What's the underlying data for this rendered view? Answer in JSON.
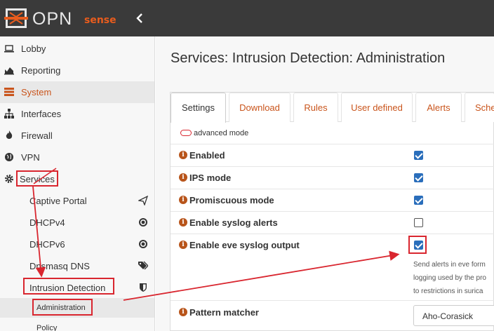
{
  "brand": {
    "word": "OPN",
    "sense": "sense",
    "collapse_icon": "chevron-left-icon"
  },
  "sidebar": {
    "items": [
      {
        "label": "Lobby",
        "icon": "laptop-icon"
      },
      {
        "label": "Reporting",
        "icon": "area-chart-icon"
      },
      {
        "label": "System",
        "icon": "server-icon"
      },
      {
        "label": "Interfaces",
        "icon": "sitemap-icon"
      },
      {
        "label": "Firewall",
        "icon": "fire-icon"
      },
      {
        "label": "VPN",
        "icon": "globe-icon"
      },
      {
        "label": "Services",
        "icon": "cog-icon"
      }
    ],
    "services_sub": [
      {
        "label": "Captive Portal",
        "icon": "paper-plane-icon"
      },
      {
        "label": "DHCPv4",
        "icon": "bullseye-icon"
      },
      {
        "label": "DHCPv6",
        "icon": "bullseye-icon"
      },
      {
        "label": "Dnsmasq DNS",
        "icon": "tags-icon"
      },
      {
        "label": "Intrusion Detection",
        "icon": "shield-icon"
      }
    ],
    "ids_sub": [
      {
        "label": "Administration"
      },
      {
        "label": "Policy"
      }
    ]
  },
  "main": {
    "title": "Services: Intrusion Detection: Administration",
    "tabs": [
      "Settings",
      "Download",
      "Rules",
      "User defined",
      "Alerts",
      "Sche"
    ],
    "advanced_mode": "advanced mode",
    "settings": [
      {
        "label": "Enabled",
        "checked": true
      },
      {
        "label": "IPS mode",
        "checked": true
      },
      {
        "label": "Promiscuous mode",
        "checked": true
      },
      {
        "label": "Enable syslog alerts",
        "checked": false
      },
      {
        "label": "Enable eve syslog output",
        "checked": true
      }
    ],
    "eve_help": [
      "Send alerts in eve form",
      "logging used by the pro",
      "to restrictions in surica"
    ],
    "pattern_matcher": {
      "label": "Pattern matcher",
      "value": "Aho-Corasick"
    }
  },
  "colors": {
    "accent": "#c9541b",
    "annotation_red": "#d9262f",
    "checkbox_blue": "#2a6ebb",
    "topbar": "#3a3a3a"
  }
}
